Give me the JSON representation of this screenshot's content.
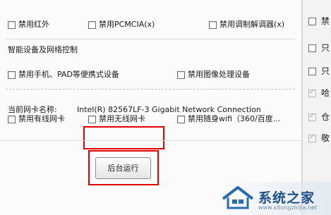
{
  "top_row": [
    {
      "label": "禁用红外"
    },
    {
      "label": "禁用PCMCIA(x)"
    },
    {
      "label": "禁用调制解调器(x)"
    }
  ],
  "smart_section": {
    "title": "智能设备及网络控制",
    "items": [
      {
        "label": "禁用手机、PAD等便携式设备"
      },
      {
        "label": "禁用图像处理设备"
      }
    ]
  },
  "network": {
    "adapter_label": "当前网卡名称:",
    "adapter_value": "Intel(R) 82567LF-3 Gigabit Network Connection",
    "items": [
      {
        "label": "禁用有线网卡"
      },
      {
        "label": "禁用无线网卡"
      },
      {
        "label": "禁用随身wifi（360/百度..."
      }
    ]
  },
  "actions": {
    "background_run_label": "后台运行"
  },
  "right_column": [
    {
      "text": "禁"
    },
    {
      "text": "只"
    },
    {
      "text": "只"
    },
    {
      "text": "哈"
    },
    {
      "text": "仓"
    },
    {
      "text": "敬"
    }
  ],
  "watermark": {
    "text": "系统之家",
    "url": "www.xitongzhijia.net"
  },
  "colors": {
    "highlight": "#e00000",
    "watermark_blue": "#1f4f86"
  }
}
